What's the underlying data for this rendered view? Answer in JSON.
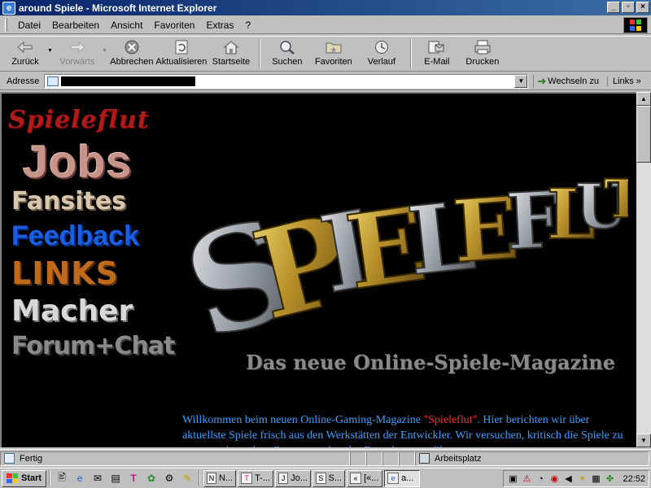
{
  "window": {
    "title": "around Spiele - Microsoft Internet Explorer",
    "minimize": "_",
    "maximize": "▫",
    "close": "×"
  },
  "menu": [
    {
      "label": "Datei",
      "u": "D"
    },
    {
      "label": "Bearbeiten",
      "u": "B"
    },
    {
      "label": "Ansicht",
      "u": "A"
    },
    {
      "label": "Favoriten",
      "u": "F"
    },
    {
      "label": "Extras",
      "u": "E"
    },
    {
      "label": "?",
      "u": ""
    }
  ],
  "toolbar": {
    "back": "Zurück",
    "forward": "Vorwärts",
    "stop": "Abbrechen",
    "refresh": "Aktualisieren",
    "home": "Startseite",
    "search": "Suchen",
    "favorites": "Favoriten",
    "history": "Verlauf",
    "mail": "E-Mail",
    "print": "Drucken"
  },
  "address": {
    "label": "Adresse",
    "go": "Wechseln zu",
    "links": "Links"
  },
  "page": {
    "nav": {
      "spieleflut": "Spieleflut",
      "jobs": "Jobs",
      "fansites": "Fansites",
      "feedback": "Feedback",
      "links": "LINKS",
      "macher": "Macher",
      "forum": "Forum+Chat"
    },
    "logo_text": "SPIELEFLUT",
    "headline": "Das neue Online-Spiele-Magazine",
    "intro_1": "Willkommen beim neuen Online-Gaming-Magazine ",
    "intro_highlight": "\"Spieleflut\"",
    "intro_2": ". Hier berichten wir über aktuellste Spiele frisch aus den Werkstätten der Entwickler. Wir versuchen, kritisch die Spiele zu testen und aus dem Gesamtangebot das Beste herauszufiltern."
  },
  "status": {
    "left": "Fertig",
    "zone": "Arbeitsplatz"
  },
  "taskbar": {
    "start": "Start",
    "tasks": [
      "N...",
      "T-...",
      "Jo...",
      "S...",
      "[«...",
      "a..."
    ],
    "clock": "22:52"
  },
  "colors": {
    "title_start": "#0a246a",
    "title_end": "#3a6ea5",
    "page_bg": "#000000",
    "intro_text": "#3aa0ff",
    "intro_highlight": "#ff2a2a"
  }
}
